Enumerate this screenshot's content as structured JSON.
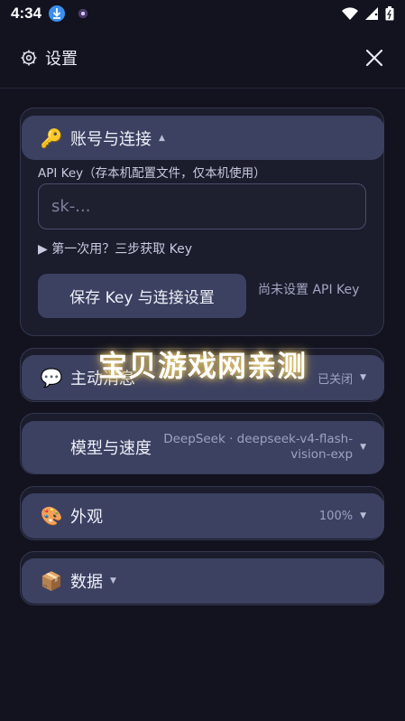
{
  "status_bar": {
    "time": "4:34"
  },
  "header": {
    "title": "设置",
    "gear_icon": "gear-icon",
    "close_icon": "close-icon"
  },
  "account": {
    "emoji": "🔑",
    "title": "账号与连接",
    "caret": "▲",
    "field_label": "API Key（存本机配置文件，仅本机使用）",
    "placeholder": "sk-...",
    "help_link": "▶ 第一次用？三步获取 Key",
    "save_button": "保存 Key 与连接设置",
    "key_status": "尚未设置 API Key"
  },
  "sections": {
    "proactive": {
      "emoji": "💬",
      "title": "主动消息",
      "value": "已关闭",
      "caret": "▼"
    },
    "model": {
      "title": "模型与速度",
      "value": "DeepSeek · deepseek-v4-flash-vision-exp",
      "caret": "▼"
    },
    "appearance": {
      "emoji": "🎨",
      "title": "外观",
      "value": "100%",
      "caret": "▼"
    },
    "data": {
      "emoji": "📦",
      "title": "数据",
      "caret": "▼"
    }
  },
  "watermark": "宝贝游戏网亲测",
  "colors": {
    "background": "#12131f",
    "bar": "#3c4162",
    "accent_download": "#3b8ff0"
  }
}
